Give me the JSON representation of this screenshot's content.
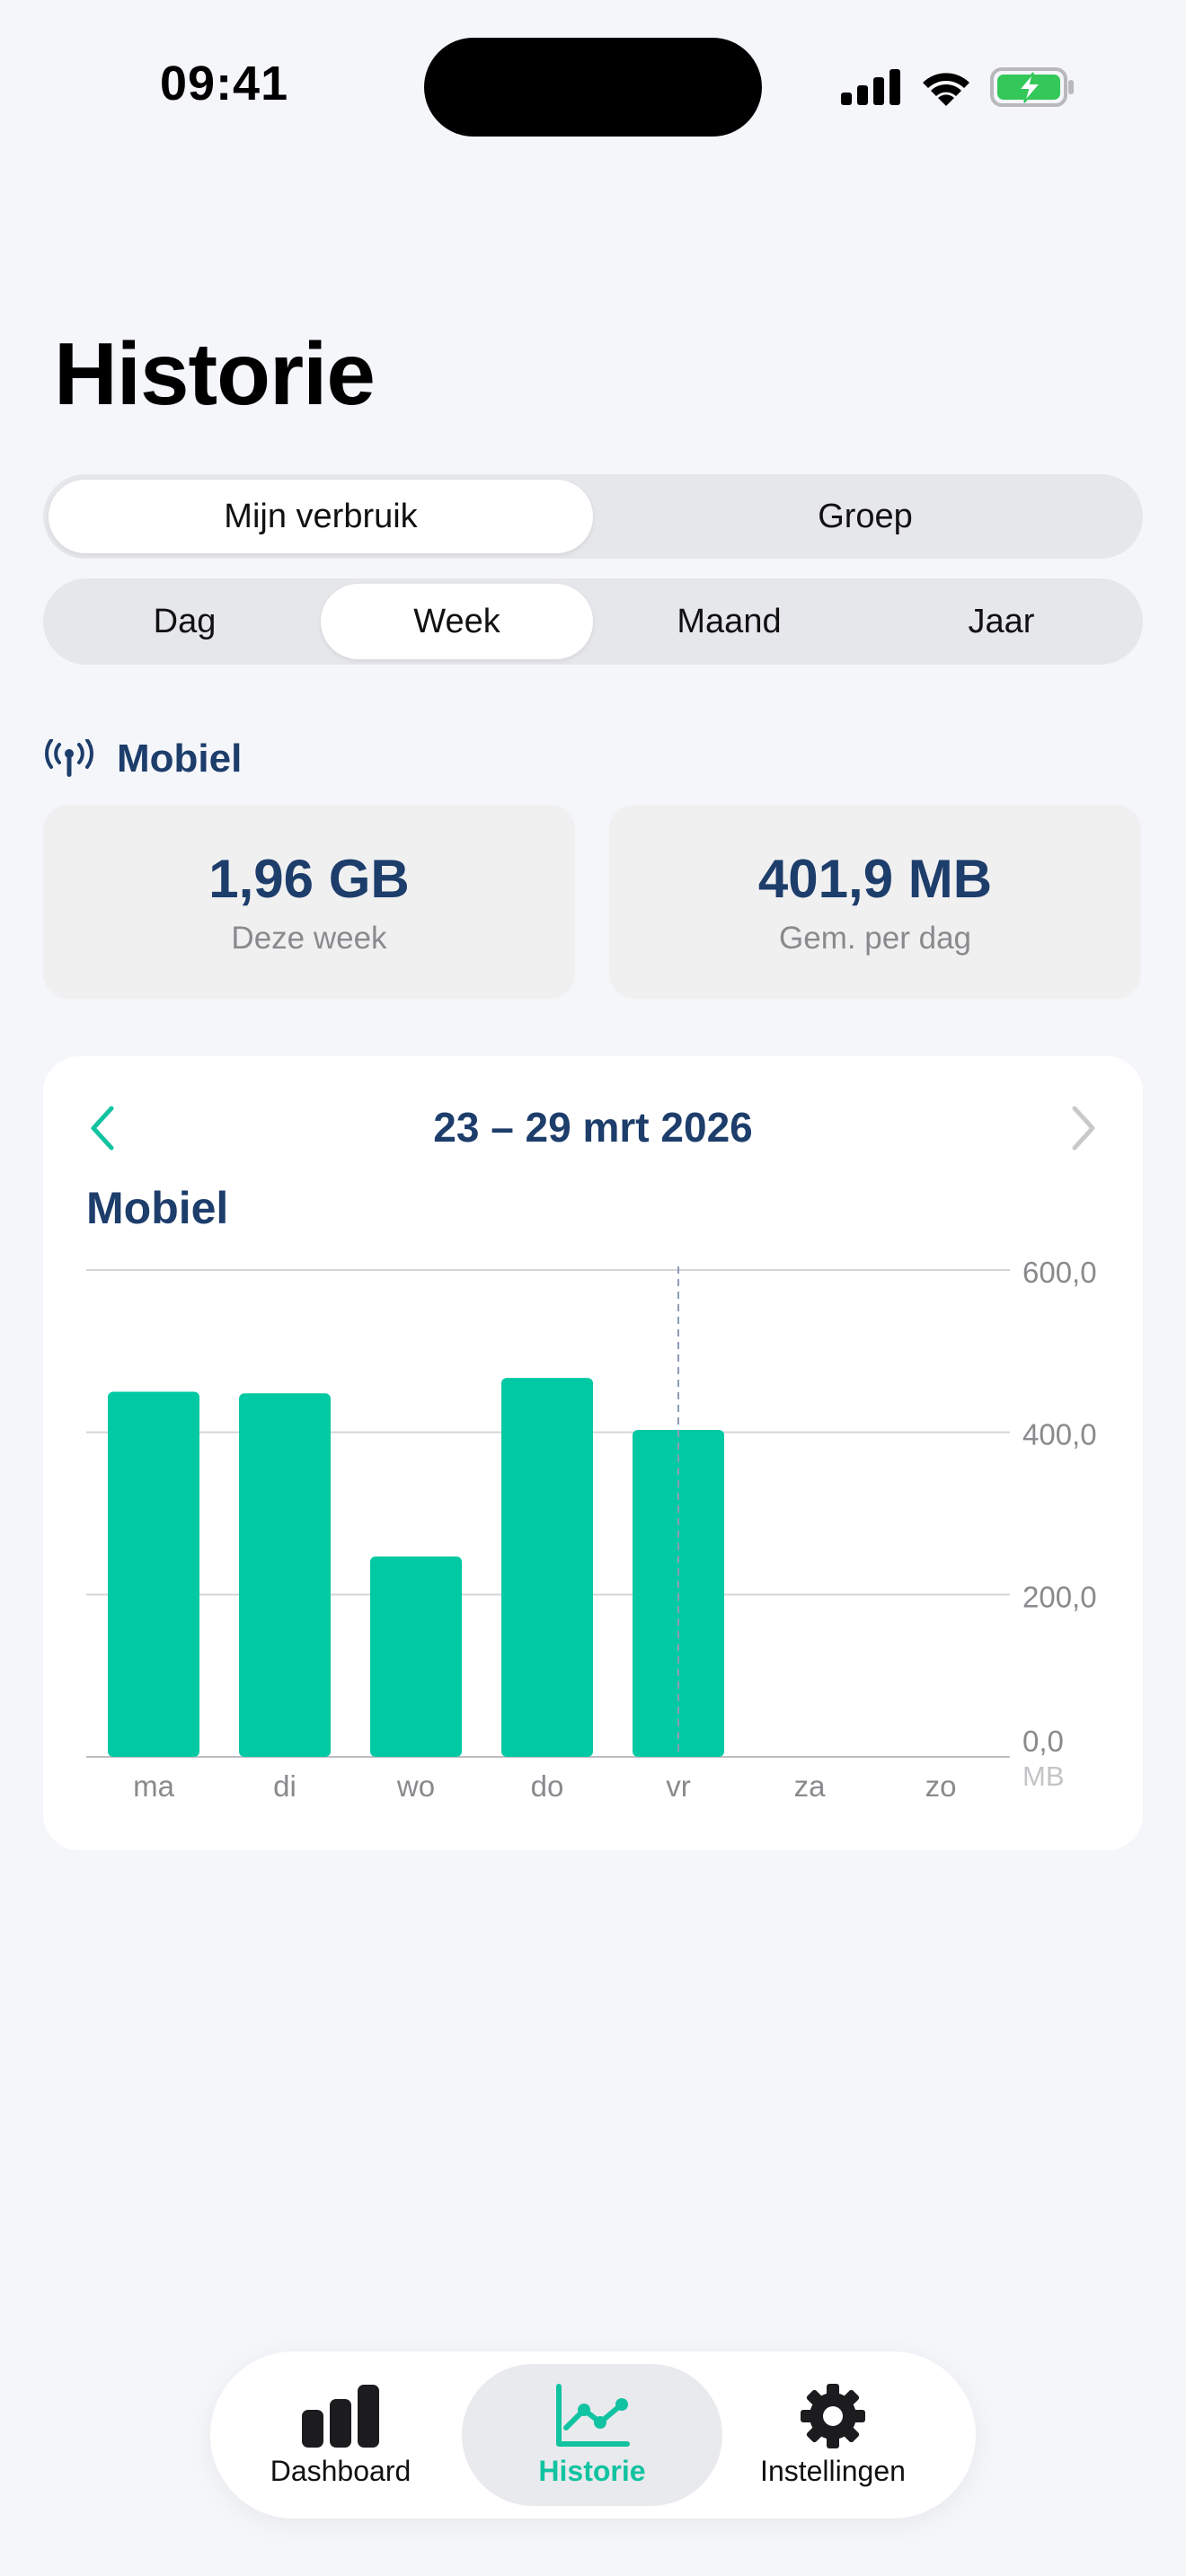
{
  "status": {
    "time": "09:41"
  },
  "page": {
    "title": "Historie"
  },
  "scope_tabs": [
    {
      "label": "Mijn verbruik",
      "active": true
    },
    {
      "label": "Groep",
      "active": false
    }
  ],
  "period_tabs": [
    {
      "label": "Dag",
      "active": false
    },
    {
      "label": "Week",
      "active": true
    },
    {
      "label": "Maand",
      "active": false
    },
    {
      "label": "Jaar",
      "active": false
    }
  ],
  "section": {
    "title": "Mobiel",
    "icon": "antenna-icon"
  },
  "stats": {
    "week_total": {
      "value": "1,96 GB",
      "label": "Deze week"
    },
    "daily_avg": {
      "value": "401,9 MB",
      "label": "Gem. per dag"
    }
  },
  "chart": {
    "range": "23 – 29 mrt 2026",
    "series_title": "Mobiel"
  },
  "chart_data": {
    "type": "bar",
    "categories": [
      "ma",
      "di",
      "wo",
      "do",
      "vr",
      "za",
      "zo"
    ],
    "values": [
      450,
      448,
      247,
      467,
      403,
      null,
      null
    ],
    "ylim": [
      0,
      600
    ],
    "yticks": [
      "600,0",
      "400,0",
      "200,0",
      "0,0"
    ],
    "yticks_values": [
      600,
      400,
      200,
      0
    ],
    "yunit": "MB",
    "grid": true,
    "selected_category": "vr",
    "bar_color": "#00c9a3"
  },
  "colors": {
    "accent": "#12c3a1",
    "heading": "#1d3d6b",
    "bar": "#00c9a3"
  },
  "tabbar": [
    {
      "label": "Dashboard",
      "icon": "bar-chart-icon",
      "active": false
    },
    {
      "label": "Historie",
      "icon": "line-chart-icon",
      "active": true
    },
    {
      "label": "Instellingen",
      "icon": "gear-icon",
      "active": false
    }
  ]
}
